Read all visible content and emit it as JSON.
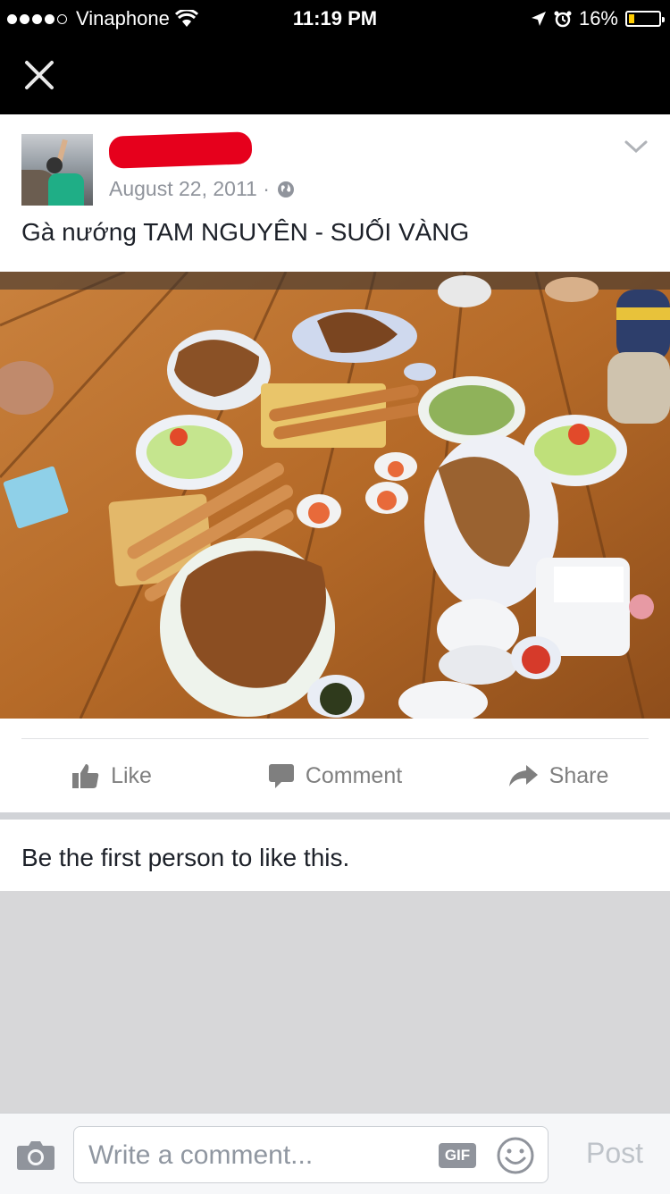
{
  "status_bar": {
    "carrier": "Vinaphone",
    "time": "11:19 PM",
    "battery": "16%",
    "battery_level": 0.16
  },
  "post": {
    "date": "August 22, 2011 ·",
    "text": "Gà nướng TAM NGUYÊN - SUỐI VÀNG",
    "actions": {
      "like": "Like",
      "comment": "Comment",
      "share": "Share"
    },
    "likes_summary": "Be the first person to like this."
  },
  "comment_bar": {
    "placeholder": "Write a comment...",
    "gif_label": "GIF",
    "post_label": "Post"
  },
  "colors": {
    "brand_gray": "#90949c",
    "battery_fill": "#ffcc00",
    "redaction": "#e6001c"
  },
  "icons": [
    "signal-icon",
    "wifi-icon",
    "location-arrow-icon",
    "alarm-icon",
    "battery-icon",
    "close-icon",
    "chevron-down-icon",
    "globe-icon",
    "like-icon",
    "comment-icon",
    "share-icon",
    "camera-icon",
    "gif-icon",
    "emoji-icon"
  ]
}
